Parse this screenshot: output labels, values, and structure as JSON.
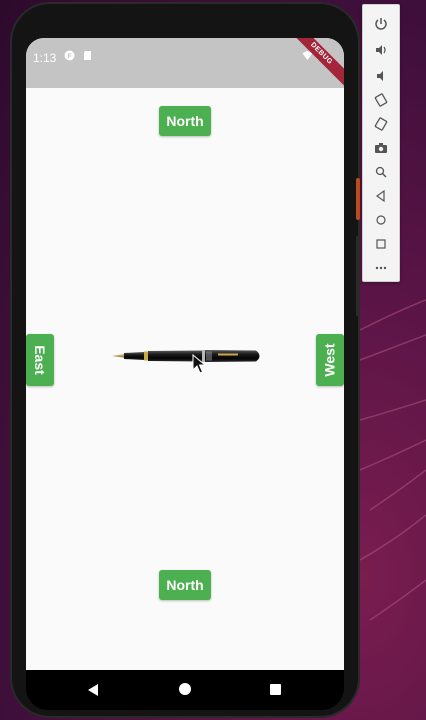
{
  "status": {
    "time": "1:13",
    "debug_banner": "DEBUG"
  },
  "buttons": {
    "north_top": "North",
    "north_bottom": "North",
    "east": "East",
    "west": "West"
  },
  "colors": {
    "button_green": "#4caf50",
    "status_bar": "#c4c4c4",
    "debug_banner": "#a3253a"
  },
  "emulator_toolbar": {
    "items": [
      "power-icon",
      "volume-up-icon",
      "volume-down-icon",
      "rotate-left-icon",
      "rotate-right-icon",
      "camera-icon",
      "zoom-icon",
      "back-icon",
      "home-icon",
      "overview-icon",
      "more-icon"
    ]
  },
  "navbar": {
    "items": [
      "back-icon",
      "home-icon",
      "recents-icon"
    ]
  }
}
